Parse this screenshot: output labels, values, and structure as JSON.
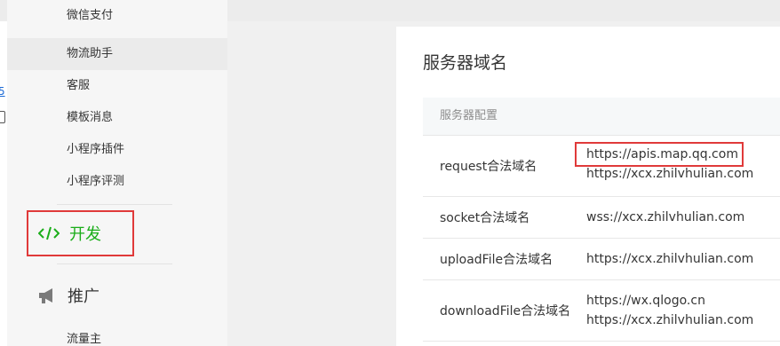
{
  "sidebar": {
    "items": [
      {
        "label": "微信支付"
      },
      {
        "label": "物流助手"
      },
      {
        "label": "客服"
      },
      {
        "label": "模板消息"
      },
      {
        "label": "小程序插件"
      },
      {
        "label": "小程序评测"
      }
    ],
    "sections": [
      {
        "label": "开发",
        "icon": "code-icon"
      },
      {
        "label": "推广",
        "icon": "megaphone-icon"
      }
    ],
    "partial_item": {
      "label": "流量主"
    }
  },
  "main": {
    "title": "服务器域名",
    "table_header": "服务器配置",
    "rows": [
      {
        "key": "request合法域名",
        "values": [
          "https://apis.map.qq.com",
          "https://xcx.zhilvhulian.com"
        ]
      },
      {
        "key": "socket合法域名",
        "values": [
          "wss://xcx.zhilvhulian.com"
        ]
      },
      {
        "key": "uploadFile合法域名",
        "values": [
          "https://xcx.zhilvhulian.com"
        ]
      },
      {
        "key": "downloadFile合法域名",
        "values": [
          "https://wx.qlogo.cn",
          "https://xcx.zhilvhulian.com"
        ]
      }
    ]
  },
  "colors": {
    "accent": "#1aad19",
    "highlight": "#e03a3a"
  }
}
